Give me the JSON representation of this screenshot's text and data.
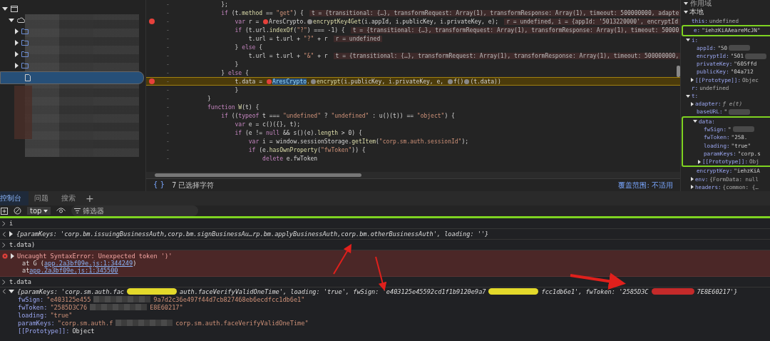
{
  "file_tree": [
    {
      "kind": "window",
      "expanded": true,
      "selected": false,
      "children": [
        {
          "kind": "cloud",
          "expanded": true,
          "selected": false,
          "children": [
            {
              "kind": "folder",
              "expanded": false,
              "selected": false
            },
            {
              "kind": "folder",
              "expanded": false,
              "selected": false
            },
            {
              "kind": "folder",
              "expanded": false,
              "selected": false
            },
            {
              "kind": "folder",
              "expanded": false,
              "selected": false
            },
            {
              "kind": "file",
              "selected": true
            }
          ]
        }
      ]
    }
  ],
  "editor": {
    "lines": [
      {
        "line_number": "-",
        "breakpoint": false,
        "paused": false,
        "parts": [
          {
            "kind": "code",
            "text": "    };"
          }
        ]
      },
      {
        "line_number": "-",
        "breakpoint": false,
        "paused": false,
        "parts": [
          {
            "kind": "keyword",
            "text": "    if"
          },
          {
            "kind": "code",
            "text": " (t."
          },
          {
            "kind": "prop",
            "text": "method"
          },
          {
            "kind": "code",
            "text": " == "
          },
          {
            "kind": "string",
            "text": "\"get\""
          },
          {
            "kind": "code",
            "text": ") {"
          }
        ],
        "inline_value": "t = {transitional: {…}, transformRequest: Array(1), transformResponse: Array(1), timeout: 500000000, adapte"
      },
      {
        "line_number": "-",
        "breakpoint": true,
        "paused": false,
        "parts": [
          {
            "kind": "keyword",
            "text": "        var"
          },
          {
            "kind": "code",
            "text": " r = "
          },
          {
            "kind": "marker_active"
          },
          {
            "kind": "code",
            "text": "AresCrypto."
          },
          {
            "kind": "marker_inactive"
          },
          {
            "kind": "prop",
            "text": "encryptKey4Get"
          },
          {
            "kind": "code",
            "text": "(i.appId, i.publicKey, i.privateKey, e);"
          }
        ],
        "inline_value": "r = undefined, i = {appId: '5013220000', encryptId"
      },
      {
        "line_number": "-",
        "breakpoint": false,
        "paused": false,
        "parts": [
          {
            "kind": "keyword",
            "text": "        if"
          },
          {
            "kind": "code",
            "text": " (t.url."
          },
          {
            "kind": "prop",
            "text": "indexOf"
          },
          {
            "kind": "code",
            "text": "("
          },
          {
            "kind": "string",
            "text": "\"?\""
          },
          {
            "kind": "code",
            "text": ") === -1) {"
          }
        ],
        "inline_value": "t = {transitional: {…}, transformRequest: Array(1), transformResponse: Array(1), timeout: 50000"
      },
      {
        "line_number": "-",
        "breakpoint": false,
        "paused": false,
        "parts": [
          {
            "kind": "code",
            "text": "            t.url = t.url + "
          },
          {
            "kind": "string",
            "text": "\"?\""
          },
          {
            "kind": "code",
            "text": " + r"
          }
        ],
        "inline_value": "r = undefined"
      },
      {
        "line_number": "-",
        "breakpoint": false,
        "paused": false,
        "parts": [
          {
            "kind": "code",
            "text": "        } "
          },
          {
            "kind": "keyword",
            "text": "else"
          },
          {
            "kind": "code",
            "text": " {"
          }
        ]
      },
      {
        "line_number": "-",
        "breakpoint": false,
        "paused": false,
        "parts": [
          {
            "kind": "code",
            "text": "            t.url = t.url + "
          },
          {
            "kind": "string",
            "text": "\"&\""
          },
          {
            "kind": "code",
            "text": " + r"
          }
        ],
        "inline_value": "t = {transitional: {…}, transformRequest: Array(1), transformResponse: Array(1), timeout: 500000000,"
      },
      {
        "line_number": "-",
        "breakpoint": false,
        "paused": false,
        "parts": [
          {
            "kind": "code",
            "text": "        }"
          }
        ]
      },
      {
        "line_number": "-",
        "breakpoint": false,
        "paused": false,
        "parts": [
          {
            "kind": "code",
            "text": "    } "
          },
          {
            "kind": "keyword",
            "text": "else"
          },
          {
            "kind": "code",
            "text": " {"
          }
        ]
      },
      {
        "line_number": "-",
        "breakpoint": true,
        "paused": true,
        "parts": [
          {
            "kind": "code",
            "text": "        t.data = "
          },
          {
            "kind": "marker_active"
          },
          {
            "kind": "selection",
            "text": "AresCrypto"
          },
          {
            "kind": "code",
            "text": "."
          },
          {
            "kind": "marker_inactive"
          },
          {
            "kind": "prop",
            "text": "encrypt"
          },
          {
            "kind": "code",
            "text": "(i.publicKey, i.privateKey, e, "
          },
          {
            "kind": "marker_inactive"
          },
          {
            "kind": "code",
            "text": "f()"
          },
          {
            "kind": "marker_inactive"
          },
          {
            "kind": "code",
            "text": "(t.data))"
          }
        ]
      },
      {
        "line_number": "-",
        "breakpoint": false,
        "paused": false,
        "parts": [
          {
            "kind": "code",
            "text": "        }"
          }
        ]
      },
      {
        "line_number": "-",
        "breakpoint": false,
        "paused": false,
        "parts": [
          {
            "kind": "code",
            "text": "}"
          }
        ]
      },
      {
        "line_number": "-",
        "breakpoint": false,
        "paused": false,
        "parts": [
          {
            "kind": "keyword",
            "text": "function"
          },
          {
            "kind": "prop",
            "text": " W"
          },
          {
            "kind": "code",
            "text": "(t) {"
          }
        ]
      },
      {
        "line_number": "-",
        "breakpoint": false,
        "paused": false,
        "parts": [
          {
            "kind": "keyword",
            "text": "    if"
          },
          {
            "kind": "code",
            "text": " (("
          },
          {
            "kind": "keyword",
            "text": "typeof"
          },
          {
            "kind": "code",
            "text": " t === "
          },
          {
            "kind": "string",
            "text": "\"undefined\""
          },
          {
            "kind": "code",
            "text": " ? "
          },
          {
            "kind": "string",
            "text": "\"undefined\""
          },
          {
            "kind": "code",
            "text": " : u()(t)) == "
          },
          {
            "kind": "string",
            "text": "\"object\""
          },
          {
            "kind": "code",
            "text": ") {"
          }
        ]
      },
      {
        "line_number": "-",
        "breakpoint": false,
        "paused": false,
        "parts": [
          {
            "kind": "keyword",
            "text": "        var"
          },
          {
            "kind": "code",
            "text": " e = c()({}, t);"
          }
        ]
      },
      {
        "line_number": "-",
        "breakpoint": false,
        "paused": false,
        "parts": [
          {
            "kind": "keyword",
            "text": "        if"
          },
          {
            "kind": "code",
            "text": " (e != "
          },
          {
            "kind": "keyword",
            "text": "null"
          },
          {
            "kind": "code",
            "text": " && s()(e)."
          },
          {
            "kind": "prop",
            "text": "length"
          },
          {
            "kind": "code",
            "text": " > 0) {"
          }
        ]
      },
      {
        "line_number": "-",
        "breakpoint": false,
        "paused": false,
        "parts": [
          {
            "kind": "keyword",
            "text": "            var"
          },
          {
            "kind": "code",
            "text": " i = window.sessionStorage."
          },
          {
            "kind": "prop",
            "text": "getItem"
          },
          {
            "kind": "code",
            "text": "("
          },
          {
            "kind": "string",
            "text": "\"corp.sm.auth.sessionId\""
          },
          {
            "kind": "code",
            "text": ");"
          }
        ]
      },
      {
        "line_number": "-",
        "breakpoint": false,
        "paused": false,
        "parts": [
          {
            "kind": "keyword",
            "text": "            if"
          },
          {
            "kind": "code",
            "text": " (e."
          },
          {
            "kind": "prop",
            "text": "hasOwnProperty"
          },
          {
            "kind": "code",
            "text": "("
          },
          {
            "kind": "string",
            "text": "\"fwToken\""
          },
          {
            "kind": "code",
            "text": ")) {"
          }
        ]
      },
      {
        "line_number": "-",
        "breakpoint": false,
        "paused": false,
        "parts": [
          {
            "kind": "keyword",
            "text": "                delete"
          },
          {
            "kind": "code",
            "text": " e.fwToken"
          }
        ]
      }
    ]
  },
  "status_bar": {
    "pretty_print": "{ }",
    "selection": "7 已选择字符",
    "coverage": "覆盖范围: 不适用"
  },
  "scope": {
    "title": "作用域",
    "sections": [
      {
        "label": "本地",
        "expanded": true,
        "items": [
          {
            "key": "this:",
            "value": "undefined",
            "kind": "plain",
            "highlighted": false
          },
          {
            "key": "e:",
            "value": "\"iehzKiAAeareMcJN\"",
            "kind": "string",
            "highlighted": true
          },
          {
            "key": "i:",
            "kind": "object",
            "expanded": true,
            "highlighted": false,
            "children": [
              {
                "key": "appId:",
                "value": "\"50",
                "kind": "redacted",
                "highlighted": false
              },
              {
                "key": "encryptId:",
                "value": "\"501",
                "kind": "redacted",
                "highlighted": false
              },
              {
                "key": "privateKey:",
                "value": "\"605ffd",
                "kind": "string",
                "highlighted": false
              },
              {
                "key": "publicKey:",
                "value": "\"04a712",
                "kind": "string",
                "highlighted": false
              },
              {
                "key": "[[Prototype]]:",
                "value": "Objec",
                "kind": "object",
                "expanded": false,
                "highlighted": false
              }
            ]
          },
          {
            "key": "r:",
            "value": "undefined",
            "kind": "plain",
            "highlighted": false
          },
          {
            "key": "t:",
            "kind": "object",
            "expanded": true,
            "highlighted": false,
            "children": [
              {
                "key": "adapter:",
                "value": "ƒ e(t)",
                "kind": "function",
                "expanded": false,
                "highlighted": false
              },
              {
                "key": "baseURL:",
                "value": "\"",
                "kind": "redacted",
                "highlighted": false
              },
              {
                "key": "data:",
                "kind": "object",
                "expanded": true,
                "highlighted": true,
                "children": [
                  {
                    "key": "fwSign:",
                    "value": "\"",
                    "kind": "redacted",
                    "highlighted": false
                  },
                  {
                    "key": "fwToken:",
                    "value": "\"258.",
                    "kind": "string",
                    "highlighted": false
                  },
                  {
                    "key": "loading:",
                    "value": "\"true\"",
                    "kind": "string",
                    "highlighted": false
                  },
                  {
                    "key": "paramKeys:",
                    "value": "\"corp.s",
                    "kind": "string",
                    "highlighted": false
                  },
                  {
                    "key": "[[Prototype]]:",
                    "value": "Obj",
                    "kind": "object",
                    "expanded": false,
                    "highlighted": false
                  }
                ]
              },
              {
                "key": "encryptKey:",
                "value": "\"iehzKiA",
                "kind": "string",
                "highlighted": false
              },
              {
                "key": "env:",
                "value": "{FormData: null",
                "kind": "object",
                "expanded": false,
                "highlighted": false
              },
              {
                "key": "headers:",
                "value": "{common: {…",
                "kind": "object",
                "expanded": false,
                "highlighted": false
              }
            ]
          }
        ]
      }
    ]
  },
  "console": {
    "tabs": [
      {
        "label": "控制台",
        "selected": true
      },
      {
        "label": "问题",
        "selected": false
      },
      {
        "label": "搜索",
        "selected": false
      }
    ],
    "add_tab": "+",
    "context": "top",
    "filter": {
      "placeholder": "筛选器"
    },
    "entries": [
      {
        "kind": "input",
        "text": "i"
      },
      {
        "kind": "output",
        "text": "{paramKeys: 'corp.bm.issuingBusinessAuth,corp.bm.signBusinessAu…rp.bm.applyBusinessAuth,corp.bm.otherBusinessAuth', loading: ''}"
      },
      {
        "kind": "input",
        "text": "t.data)"
      },
      {
        "kind": "error",
        "text": "Uncaught SyntaxError: Unexpected token ')'",
        "stack": [
          {
            "prefix": "at G (",
            "link": "app.2a3bf09e.js:1:344249",
            "suffix": ")"
          },
          {
            "prefix": "at",
            "link": "app.2a3bf09e.js:1:345500"
          }
        ]
      },
      {
        "kind": "input",
        "text": "t.data"
      },
      {
        "kind": "object",
        "expanded": true,
        "summary": [
          {
            "kind": "text",
            "text": "{paramKeys: 'corp.sm.auth.fac"
          },
          {
            "kind": "yellow_marker"
          },
          {
            "kind": "text",
            "text": "auth.faceVerifyValidOneTime', loading: 'true', fwSign: 'e403125e45592cd1f1b9120e9a7"
          },
          {
            "kind": "yellow_marker"
          },
          {
            "kind": "text",
            "text": "fcc1db6e1', fwToken: '2585D3C"
          },
          {
            "kind": "red_marker"
          },
          {
            "kind": "text",
            "text": "7E8E60217'}"
          }
        ],
        "children": [
          {
            "key": "fwSign:",
            "kind": "string",
            "parts": [
              {
                "kind": "text",
                "text": "\"e403125e455"
              },
              {
                "kind": "pixelated"
              },
              {
                "kind": "text",
                "text": "9a7d2c36e497f44d7cb827468eb6ecdfcc1db6e1\""
              }
            ]
          },
          {
            "key": "fwToken:",
            "kind": "string",
            "parts": [
              {
                "kind": "text",
                "text": "\"2585D3C76"
              },
              {
                "kind": "pixelated"
              },
              {
                "kind": "text",
                "text": "E8E60217\""
              }
            ]
          },
          {
            "key": "loading:",
            "kind": "string",
            "parts": [
              {
                "kind": "text",
                "text": "\"true\""
              }
            ]
          },
          {
            "key": "paramKeys:",
            "kind": "string",
            "parts": [
              {
                "kind": "text",
                "text": "\"corp.sm.auth.f"
              },
              {
                "kind": "pixelated"
              },
              {
                "kind": "text",
                "text": "corp.sm.auth.faceVerifyValidOneTime\""
              }
            ]
          },
          {
            "key": "[[Prototype]]:",
            "kind": "object",
            "parts": [
              {
                "kind": "text",
                "text": "Object"
              }
            ]
          }
        ]
      }
    ]
  }
}
